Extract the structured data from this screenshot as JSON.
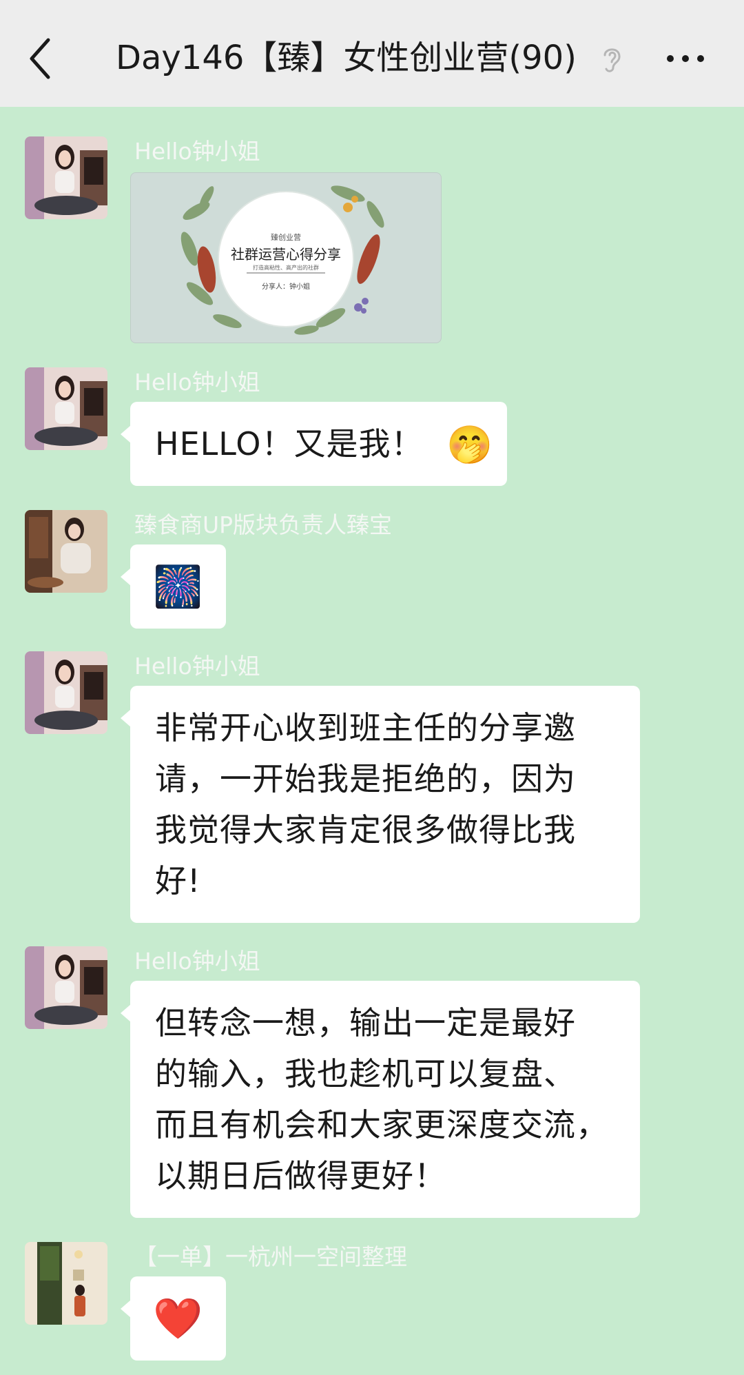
{
  "header": {
    "title": "Day146【臻】女性创业营(90)"
  },
  "messages": [
    {
      "sender": "Hello钟小姐",
      "type": "image",
      "card": {
        "brand": "臻创业营",
        "title": "社群运营心得分享",
        "subtitle": "打造高粘性、高产出的社群",
        "presenter": "分享人：钟小姐"
      }
    },
    {
      "sender": "Hello钟小姐",
      "type": "text",
      "text": "HELLO！又是我！",
      "emoji": "🤭"
    },
    {
      "sender": "臻食商UP版块负责人臻宝",
      "type": "emoji",
      "emoji": "🎆"
    },
    {
      "sender": "Hello钟小姐",
      "type": "text",
      "lines": [
        "非常开心收到班主任的分享邀",
        "请，一开始我是拒绝的，因为",
        "我觉得大家肯定很多做得比我",
        "好!"
      ]
    },
    {
      "sender": "Hello钟小姐",
      "type": "text",
      "lines": [
        "但转念一想，输出一定是最好",
        "的输入，我也趁机可以复盘、",
        "而且有机会和大家更深度交流，",
        "以期日后做得更好！"
      ]
    },
    {
      "sender": "【一单】一杭州一空间整理",
      "type": "emoji",
      "emoji": "❤️"
    }
  ],
  "icons": {
    "back": "chevron-left-icon",
    "ear": "ear-icon",
    "more": "more-dots-icon"
  }
}
